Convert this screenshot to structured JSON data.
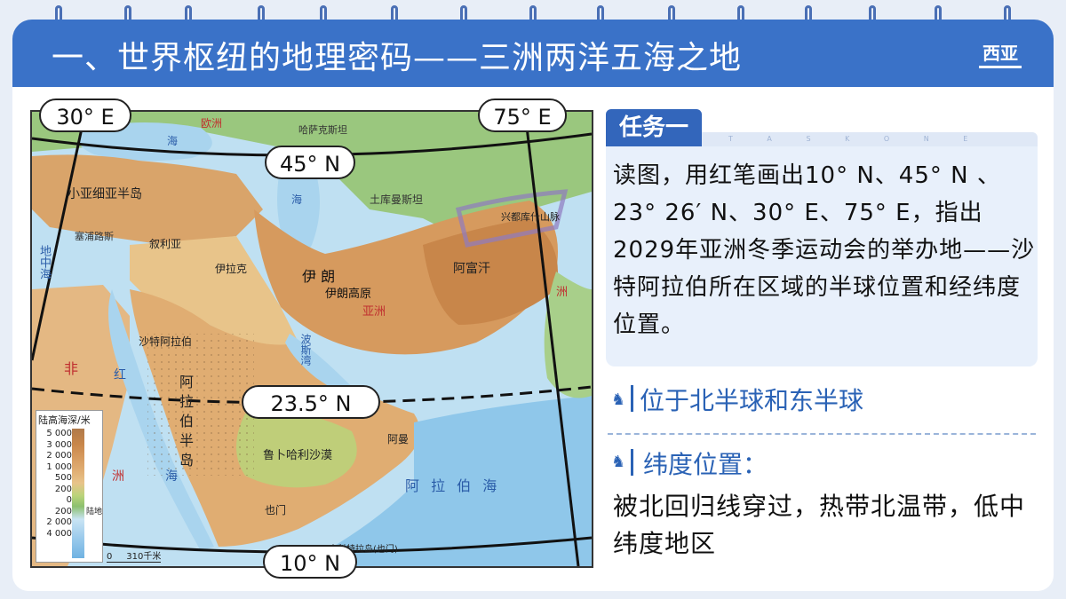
{
  "header": {
    "title": "一、世界枢纽的地理密码——三洲两洋五海之地",
    "logo": "西亚"
  },
  "map": {
    "pills": {
      "lon30": "30° E",
      "lon75": "75° E",
      "lat45": "45° N",
      "lat23": "23.5° N",
      "lat10": "10° N"
    },
    "labels": {
      "europe": "欧洲",
      "asia": "亚洲",
      "africa": "非",
      "africa2": "洲",
      "asia_right": "洲",
      "black_sea": "海",
      "caspian": "海",
      "red_sea": "红",
      "red_sea2": "海",
      "iran_plateau": "伊朗高原",
      "iran": "伊  朗",
      "afghanistan": "阿富汗",
      "arabian_peninsula": "阿拉伯半岛",
      "arabian_sea": "阿 拉 伯 海",
      "persian_gulf": "波斯湾",
      "rub_al_khali": "鲁卜哈利沙漠",
      "anatolia": "小亚细亚半岛",
      "mediterranean": "地中海",
      "turkmenistan": "土库曼斯坦",
      "kazakhstan": "哈萨克斯坦",
      "hindu_kush": "兴都库什山脉",
      "socotra": "索科特拉岛(也门)",
      "cyprus": "塞浦路斯",
      "syria": "叙利亚",
      "iraq": "伊拉克",
      "yemen": "也门",
      "oman": "阿曼",
      "saudi": "沙特阿拉伯"
    },
    "legend": {
      "title": "陆高海深/米",
      "levels": [
        "5 000",
        "3 000",
        "2 000",
        "1 000",
        "500",
        "200",
        "0",
        "200",
        "2 000",
        "4 000"
      ],
      "land_label": "陆地",
      "scale": "0     310千米"
    }
  },
  "task": {
    "heading": "任务一",
    "subheading": "T A S K O N E",
    "body": "读图，用红笔画出10° N、45° N 、23° 26′ N、30° E、75° E，指出2029年亚洲冬季运动会的举办地——沙特阿拉伯所在区域的半球位置和经纬度位置。"
  },
  "answers": {
    "hemisphere": "位于北半球和东半球",
    "lat_heading": "纬度位置：",
    "lat_text": "被北回归线穿过，热带北温带，低中纬度地区"
  },
  "colors": {
    "accent": "#3a72c8",
    "answer": "#2a62b5",
    "panel": "#e8f0fb"
  }
}
